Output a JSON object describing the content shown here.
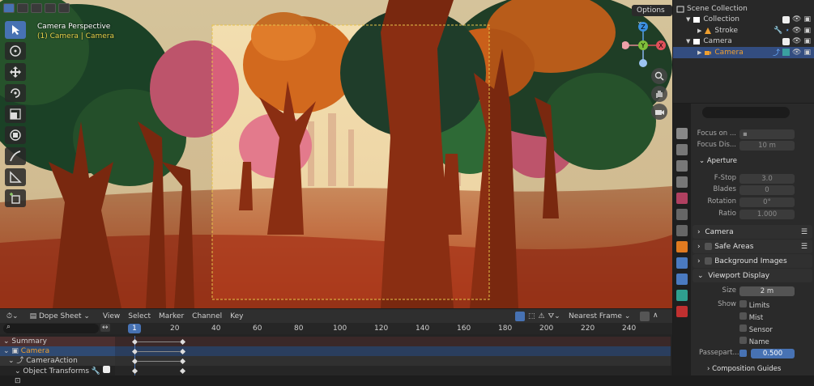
{
  "viewport": {
    "label_line1": "Camera Perspective",
    "label_line2": "(1) Camera | Camera",
    "options_label": "Options",
    "gizmo": {
      "x": "X",
      "y": "Y",
      "z": "Z"
    }
  },
  "outliner": {
    "rows": [
      {
        "name": "Scene Collection"
      },
      {
        "name": "Collection"
      },
      {
        "name": "Stroke"
      },
      {
        "name": "Camera"
      },
      {
        "name": "Camera"
      }
    ]
  },
  "properties": {
    "focus_on_label": "Focus on ...",
    "focus_distance_label": "Focus Dis...",
    "focus_distance_value": "10 m",
    "aperture_header": "Aperture",
    "fstop_label": "F-Stop",
    "fstop_value": "3.0",
    "blades_label": "Blades",
    "blades_value": "0",
    "rotation_label": "Rotation",
    "rotation_value": "0°",
    "ratio_label": "Ratio",
    "ratio_value": "1.000",
    "camera_header": "Camera",
    "safe_areas_header": "Safe Areas",
    "bg_images_header": "Background Images",
    "viewport_display_header": "Viewport Display",
    "size_label": "Size",
    "size_value": "2 m",
    "show_label": "Show",
    "show_options": [
      "Limits",
      "Mist",
      "Sensor",
      "Name"
    ],
    "passepartout_label": "Passepart...",
    "passepartout_value": "0.500",
    "composition_header": "Composition Guides"
  },
  "dopesheet": {
    "mode": "Dope Sheet",
    "menu": [
      "View",
      "Select",
      "Marker",
      "Channel",
      "Key"
    ],
    "interpolation": "Nearest Frame",
    "current_frame": "1",
    "ruler": [
      "20",
      "40",
      "60",
      "80",
      "100",
      "120",
      "140",
      "160",
      "180",
      "200",
      "220",
      "240"
    ],
    "channels": [
      {
        "name": "Summary"
      },
      {
        "name": "Camera"
      },
      {
        "name": "CameraAction"
      },
      {
        "name": "Object Transforms"
      }
    ]
  },
  "colors": {
    "accent": "#4772b3",
    "selected_row": "#334d80",
    "summary_row": "#4b2f2f",
    "camera_name": "#e6d14c",
    "trunk": "#8a2e12",
    "foliage_orange": "#d2691e",
    "foliage_green": "#1f4a2c",
    "foliage_pink": "#d8607a"
  }
}
